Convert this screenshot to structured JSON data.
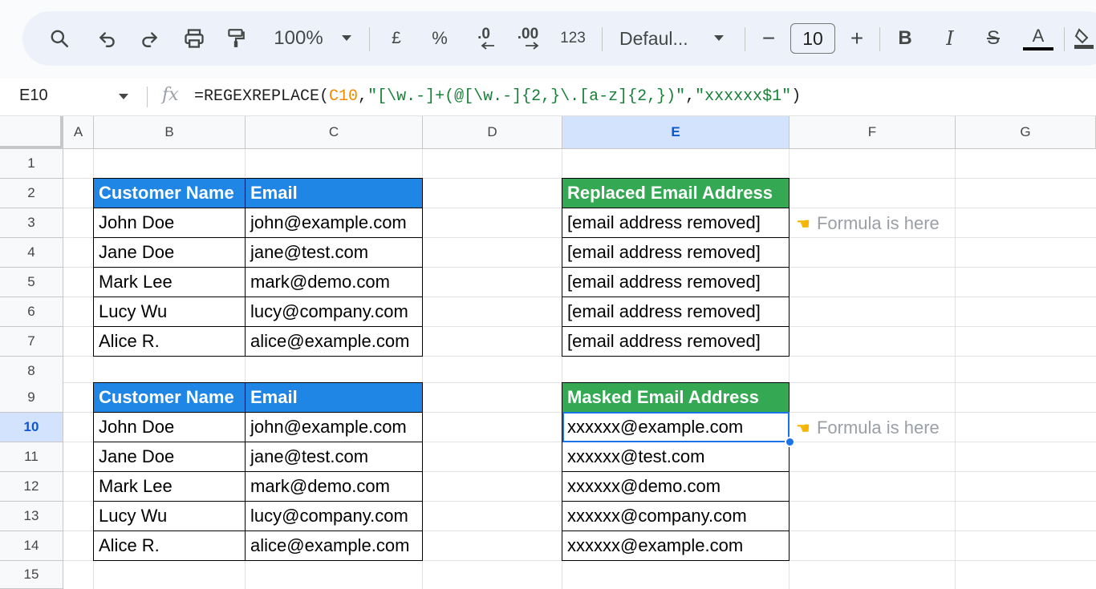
{
  "toolbar": {
    "zoom": "100%",
    "currency": "£",
    "percent": "%",
    "decrease_decimal": ".0",
    "increase_decimal": ".00",
    "number_format": "123",
    "font": "Defaul...",
    "font_size": "10",
    "minus": "−",
    "plus": "+",
    "bold": "B",
    "italic": "I",
    "strike": "S",
    "text_color": "A"
  },
  "formula_bar": {
    "name_box": "E10",
    "formula_prefix": "=REGEXREPLACE(",
    "formula_ref": "C10",
    "formula_comma1": ",",
    "formula_pattern": "\"[\\w.-]+(@[\\w.-]{2,}\\.[a-z]{2,})\"",
    "formula_comma2": ",",
    "formula_replacement": "\"xxxxxx$1\"",
    "formula_suffix": ")"
  },
  "columns": [
    "A",
    "B",
    "C",
    "D",
    "E",
    "F",
    "G"
  ],
  "rows": [
    "1",
    "2",
    "3",
    "4",
    "5",
    "6",
    "7",
    "8",
    "9",
    "10",
    "11",
    "12",
    "13",
    "14",
    "15"
  ],
  "table1": {
    "header_name": "Customer Name",
    "header_email": "Email",
    "rows": [
      {
        "name": "John Doe",
        "email": "john@example.com"
      },
      {
        "name": "Jane Doe",
        "email": "jane@test.com"
      },
      {
        "name": "Mark Lee",
        "email": "mark@demo.com"
      },
      {
        "name": "Lucy Wu",
        "email": "lucy@company.com"
      },
      {
        "name": "Alice R.",
        "email": "alice@example.com"
      }
    ]
  },
  "replaced": {
    "header": "Replaced Email Address",
    "values": [
      "[email address removed]",
      "[email address removed]",
      "[email address removed]",
      "[email address removed]",
      "[email address removed]"
    ],
    "note": "Formula is here"
  },
  "table2": {
    "header_name": "Customer Name",
    "header_email": "Email",
    "rows": [
      {
        "name": "John Doe",
        "email": "john@example.com"
      },
      {
        "name": "Jane Doe",
        "email": "jane@test.com"
      },
      {
        "name": "Mark Lee",
        "email": "mark@demo.com"
      },
      {
        "name": "Lucy Wu",
        "email": "lucy@company.com"
      },
      {
        "name": "Alice R.",
        "email": "alice@example.com"
      }
    ]
  },
  "masked": {
    "header": "Masked Email Address",
    "values": [
      "xxxxxx@example.com",
      "xxxxxx@test.com",
      "xxxxxx@demo.com",
      "xxxxxx@company.com",
      "xxxxxx@example.com"
    ],
    "note": "Formula is here"
  },
  "selected_cell": "E10",
  "colors": {
    "header_blue": "#1f86e6",
    "header_green": "#34a853",
    "selection": "#1a73e8"
  }
}
